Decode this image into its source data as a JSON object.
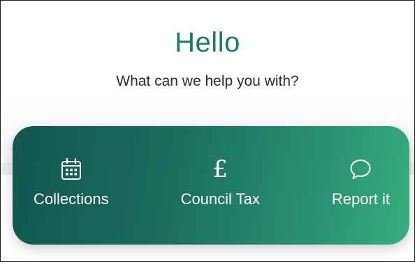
{
  "header": {
    "greeting": "Hello",
    "subtitle": "What can we help you with?"
  },
  "quick_actions": [
    {
      "label": "Collections",
      "icon": "calendar-icon"
    },
    {
      "label": "Council Tax",
      "icon": "pound-sign-icon",
      "glyph": "£"
    },
    {
      "label": "Report it",
      "icon": "speech-bubble-icon"
    }
  ],
  "colors": {
    "accent": "#1b7c6a",
    "card_gradient_start": "#11564f",
    "card_gradient_end": "#38ad7f",
    "text": "#2b2b2b"
  }
}
